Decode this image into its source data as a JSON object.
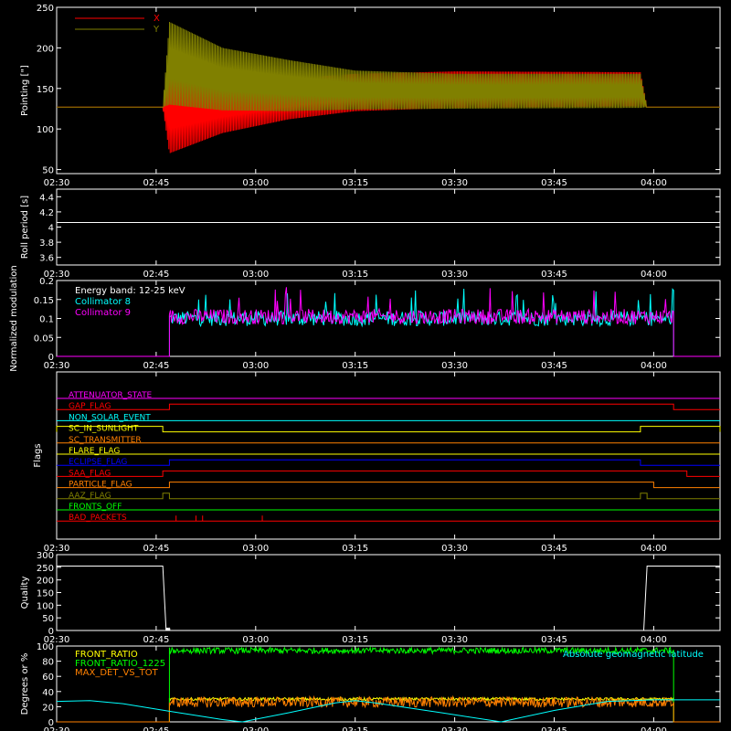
{
  "chart_data": [
    {
      "id": "pointing",
      "type": "line",
      "ylabel": "Pointing [\"]",
      "ylim": [
        45,
        250
      ],
      "yticks": [
        50,
        100,
        150,
        200,
        250
      ],
      "xlim": [
        "02:30",
        "04:10"
      ],
      "xticks": [
        "02:30",
        "02:45",
        "03:00",
        "03:15",
        "03:30",
        "03:45",
        "04:00"
      ],
      "legend": "top-left",
      "series": [
        {
          "name": "X",
          "color": "#ff0000",
          "envelope": [
            {
              "t": "02:30",
              "min": 127,
              "max": 127
            },
            {
              "t": "02:46",
              "min": 127,
              "max": 127
            },
            {
              "t": "02:47",
              "min": 70,
              "max": 165
            },
            {
              "t": "02:55",
              "min": 95,
              "max": 157
            },
            {
              "t": "03:05",
              "min": 112,
              "max": 162
            },
            {
              "t": "03:15",
              "min": 122,
              "max": 168
            },
            {
              "t": "03:30",
              "min": 126,
              "max": 171
            },
            {
              "t": "03:58",
              "min": 128,
              "max": 170
            },
            {
              "t": "03:59",
              "min": 127,
              "max": 127
            },
            {
              "t": "04:10",
              "min": 127,
              "max": 127
            }
          ]
        },
        {
          "name": "Y",
          "color": "#808000",
          "envelope": [
            {
              "t": "02:30",
              "min": 127,
              "max": 127
            },
            {
              "t": "02:46",
              "min": 127,
              "max": 127
            },
            {
              "t": "02:47",
              "min": 130,
              "max": 232
            },
            {
              "t": "02:55",
              "min": 123,
              "max": 200
            },
            {
              "t": "03:05",
              "min": 122,
              "max": 185
            },
            {
              "t": "03:15",
              "min": 124,
              "max": 172
            },
            {
              "t": "03:30",
              "min": 125,
              "max": 168
            },
            {
              "t": "03:58",
              "min": 126,
              "max": 168
            },
            {
              "t": "03:59",
              "min": 127,
              "max": 127
            },
            {
              "t": "04:10",
              "min": 127,
              "max": 127
            }
          ]
        }
      ]
    },
    {
      "id": "roll",
      "type": "line",
      "ylabel": "Roll period [s]",
      "ylim": [
        3.5,
        4.5
      ],
      "yticks": [
        3.6,
        3.8,
        4.0,
        4.2,
        4.4
      ],
      "xlim": [
        "02:30",
        "04:10"
      ],
      "xticks": [
        "02:30",
        "02:45",
        "03:00",
        "03:15",
        "03:30",
        "03:45",
        "04:00"
      ],
      "series": [
        {
          "name": "",
          "color": "#ffffff",
          "points": [
            {
              "t": "02:30",
              "v": 4.06
            },
            {
              "t": "04:10",
              "v": 4.06
            }
          ]
        }
      ]
    },
    {
      "id": "modulation",
      "type": "line",
      "ylabel": "Normalized modulation",
      "ylim": [
        0,
        0.2
      ],
      "yticks": [
        0.0,
        0.05,
        0.1,
        0.15,
        0.2
      ],
      "xlim": [
        "02:30",
        "04:10"
      ],
      "xticks": [
        "02:30",
        "02:45",
        "03:00",
        "03:15",
        "03:30",
        "03:45",
        "04:00"
      ],
      "annotation": "Energy band: 12-25 keV",
      "legend": "top-left",
      "active_range": [
        "02:47",
        "04:03"
      ],
      "series": [
        {
          "name": "Collimator 8",
          "color": "#00ffff",
          "base": 0.1,
          "spread": 0.02
        },
        {
          "name": "Collimator 9",
          "color": "#ff00ff",
          "base": 0.105,
          "spread": 0.02
        }
      ]
    },
    {
      "id": "flags",
      "type": "line",
      "ylabel": "Flags",
      "xlim": [
        "02:30",
        "04:10"
      ],
      "xticks": [
        "02:30",
        "02:45",
        "03:00",
        "03:15",
        "03:30",
        "03:45",
        "04:00"
      ],
      "series": [
        {
          "name": "ATTENUATOR_STATE",
          "color": "#ff00ff",
          "steps": []
        },
        {
          "name": "GAP_FLAG",
          "color": "#ff0000",
          "steps": [
            {
              "start": "02:47",
              "end": "04:03"
            }
          ]
        },
        {
          "name": "NON_SOLAR_EVENT",
          "color": "#00ffff",
          "steps": []
        },
        {
          "name": "SC_IN_SUNLIGHT",
          "color": "#ffff00",
          "steps": [
            {
              "start": "02:30",
              "end": "02:46"
            },
            {
              "start": "03:58",
              "end": "04:10"
            }
          ]
        },
        {
          "name": "SC_TRANSMITTER",
          "color": "#ff8000",
          "steps": []
        },
        {
          "name": "FLARE_FLAG",
          "color": "#ffff00",
          "steps": []
        },
        {
          "name": "ECLIPSE_FLAG",
          "color": "#0000ff",
          "steps": [
            {
              "start": "02:47",
              "end": "03:58"
            }
          ]
        },
        {
          "name": "SAA_FLAG",
          "color": "#ff0000",
          "steps": [
            {
              "start": "02:46",
              "end": "04:05"
            }
          ]
        },
        {
          "name": "PARTICLE_FLAG",
          "color": "#ff8000",
          "steps": [
            {
              "start": "02:47",
              "end": "04:00"
            }
          ]
        },
        {
          "name": "AAZ_FLAG",
          "color": "#808000",
          "steps": [
            {
              "start": "02:46",
              "end": "02:47"
            },
            {
              "start": "03:58",
              "end": "03:59"
            }
          ]
        },
        {
          "name": "FRONTS_OFF",
          "color": "#00ff00",
          "steps": []
        },
        {
          "name": "BAD_PACKETS",
          "color": "#ff0000",
          "spikes": [
            "02:48",
            "02:51",
            "02:52",
            "03:01"
          ]
        }
      ]
    },
    {
      "id": "quality",
      "type": "line",
      "ylabel": "Quality",
      "ylim": [
        0,
        300
      ],
      "yticks": [
        0,
        50,
        100,
        150,
        200,
        250,
        300
      ],
      "xlim": [
        "02:30",
        "04:10"
      ],
      "xticks": [
        "02:30",
        "02:45",
        "03:00",
        "03:15",
        "03:30",
        "03:45",
        "04:00"
      ],
      "series": [
        {
          "name": "",
          "color": "#ffffff",
          "points": [
            {
              "t": "02:30",
              "v": 255
            },
            {
              "t": "02:46",
              "v": 255
            },
            {
              "t": "02:46.5",
              "v": 0
            },
            {
              "t": "03:58.5",
              "v": 0
            },
            {
              "t": "03:59",
              "v": 255
            },
            {
              "t": "04:10",
              "v": 255
            }
          ]
        }
      ]
    },
    {
      "id": "ratios",
      "type": "line",
      "ylabel": "Degrees or %",
      "ylim": [
        0,
        100
      ],
      "yticks": [
        0,
        20,
        40,
        60,
        80,
        100
      ],
      "xlim": [
        "02:30",
        "04:10"
      ],
      "xticks": [
        "02:30",
        "02:45",
        "03:00",
        "03:15",
        "03:30",
        "03:45",
        "04:00"
      ],
      "legend": "top-left",
      "active_range": [
        "02:47",
        "04:03"
      ],
      "series": [
        {
          "name": "FRONT_RATIO",
          "color": "#ffff00",
          "base": 30,
          "spread": 2
        },
        {
          "name": "FRONT_RATIO_1225",
          "color": "#00ff00",
          "base": 94,
          "spread": 4
        },
        {
          "name": "MAX_DET_VS_TOT",
          "color": "#ff8000",
          "base": 26,
          "spread": 7
        },
        {
          "name": "Absolute geomagnetic latitude",
          "color": "#00ffff",
          "points": [
            {
              "t": "02:30",
              "v": 27
            },
            {
              "t": "02:35",
              "v": 28
            },
            {
              "t": "02:40",
              "v": 24
            },
            {
              "t": "02:47",
              "v": 14
            },
            {
              "t": "02:55",
              "v": 3
            },
            {
              "t": "02:58",
              "v": 0
            },
            {
              "t": "03:05",
              "v": 12
            },
            {
              "t": "03:12",
              "v": 25
            },
            {
              "t": "03:15",
              "v": 28
            },
            {
              "t": "03:18",
              "v": 25
            },
            {
              "t": "03:28",
              "v": 12
            },
            {
              "t": "03:37",
              "v": 0
            },
            {
              "t": "03:45",
              "v": 15
            },
            {
              "t": "03:53",
              "v": 27
            },
            {
              "t": "04:00",
              "v": 29
            },
            {
              "t": "04:10",
              "v": 29
            }
          ]
        }
      ]
    }
  ]
}
